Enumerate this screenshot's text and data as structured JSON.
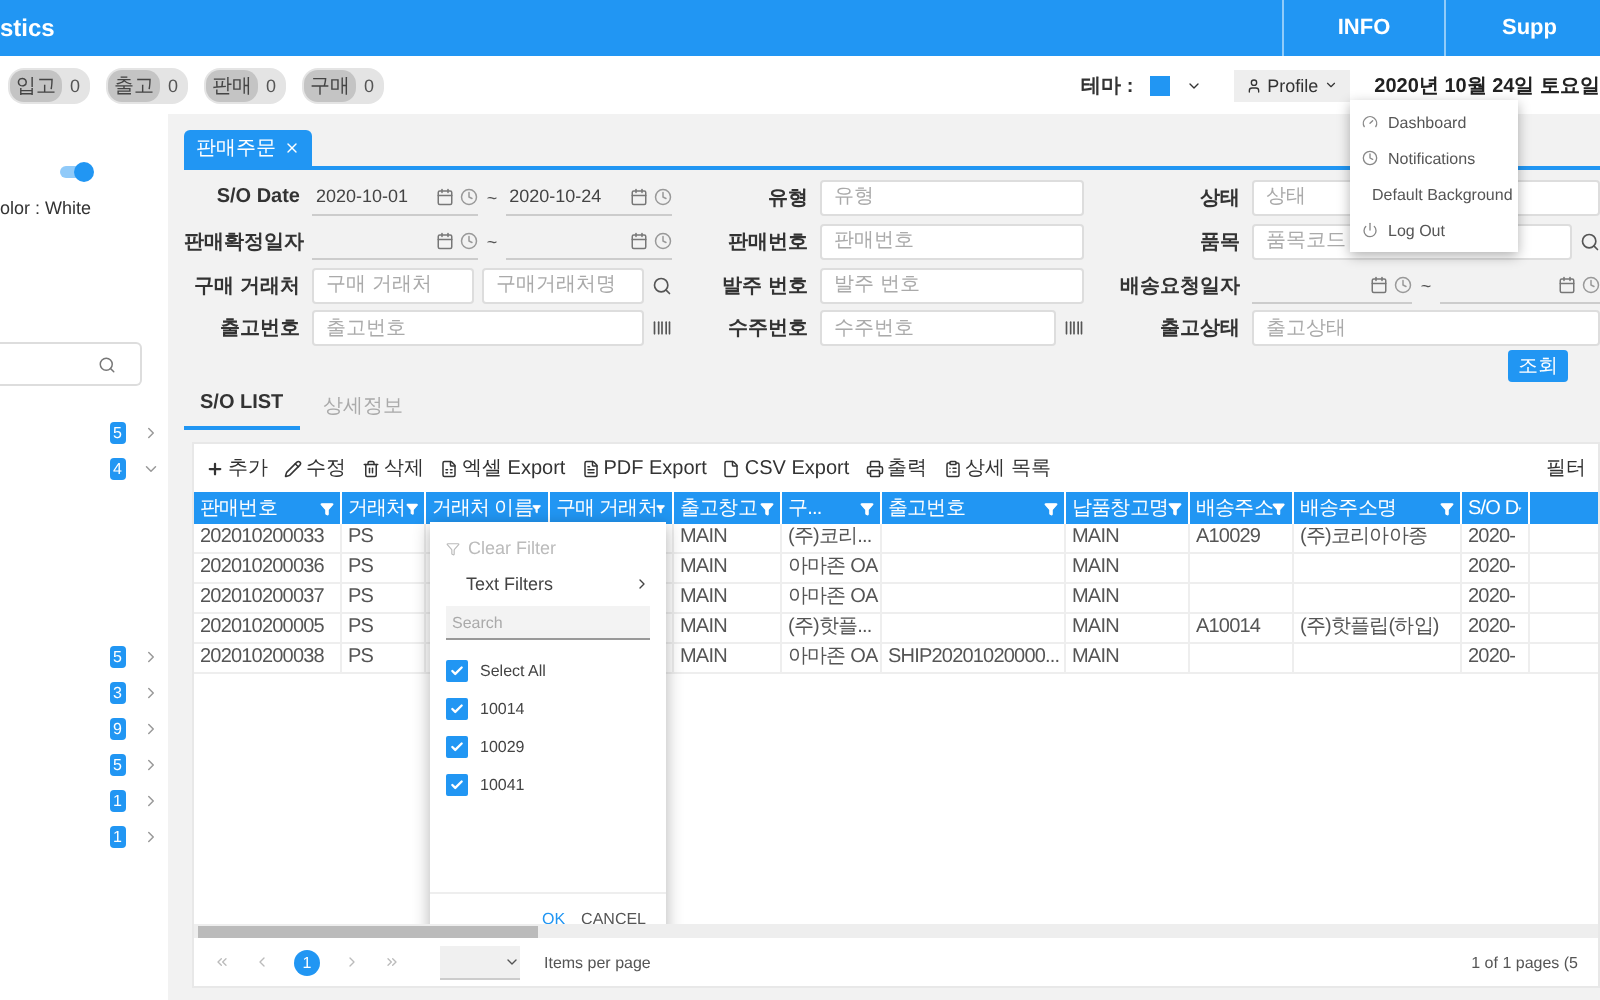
{
  "header": {
    "title": "stics",
    "nav": [
      "INFO",
      "Supp"
    ]
  },
  "counters": [
    {
      "label": "입고",
      "count": "0"
    },
    {
      "label": "출고",
      "count": "0"
    },
    {
      "label": "판매",
      "count": "0"
    },
    {
      "label": "구매",
      "count": "0"
    }
  ],
  "theme": {
    "label": "테마 :",
    "color": "#2196f3"
  },
  "profile": {
    "label": "Profile",
    "menu": [
      {
        "label": "Dashboard",
        "kind": "dashboard"
      },
      {
        "label": "Notifications",
        "kind": "notifications"
      },
      {
        "label": "Default Background",
        "kind": "background"
      },
      {
        "label": "Log Out",
        "kind": "logout"
      }
    ]
  },
  "date": "2020년 10월 24일 토요일",
  "sidebar": {
    "toggle": {
      "on": true
    },
    "theme_text": "olor : White",
    "items": [
      {
        "count": "5",
        "expanded": false
      },
      {
        "count": "4",
        "expanded": true
      },
      {
        "count": "5",
        "expanded": false
      },
      {
        "count": "3",
        "expanded": false
      },
      {
        "count": "9",
        "expanded": false
      },
      {
        "count": "5",
        "expanded": false
      },
      {
        "count": "1",
        "expanded": false
      },
      {
        "count": "1",
        "expanded": false
      }
    ]
  },
  "doc_tabs": [
    {
      "label": "판매주문",
      "selected": true
    }
  ],
  "filters": [
    {
      "kind": "date_range",
      "label": "S/O Date",
      "from": "2020-10-01",
      "separator": "~",
      "to": "2020-10-24"
    },
    {
      "kind": "text",
      "label": "유형",
      "placeholder": "유형"
    },
    {
      "kind": "text",
      "label": "상태",
      "placeholder": "상태"
    },
    {
      "kind": "date_range",
      "label": "판매확정일자",
      "separator": "~"
    },
    {
      "kind": "text",
      "label": "판매번호",
      "placeholder": "판매번호"
    },
    {
      "kind": "text_search",
      "label": "품목",
      "placeholder": "품목코드"
    },
    {
      "kind": "text_pair",
      "label": "구매 거래처",
      "placeholders": [
        "구매 거래처",
        "구매거래처명"
      ]
    },
    {
      "kind": "text",
      "label": "발주 번호",
      "placeholder": "발주 번호"
    },
    {
      "kind": "date_range",
      "label": "배송요청일자",
      "separator": "~"
    },
    {
      "kind": "text_barcode",
      "label": "출고번호",
      "placeholder": "출고번호"
    },
    {
      "kind": "text_barcode",
      "label": "수주번호",
      "placeholder": "수주번호"
    },
    {
      "kind": "text",
      "label": "출고상태",
      "placeholder": "출고상태"
    }
  ],
  "search_button": "조회",
  "list_tabs": [
    {
      "label": "S/O LIST",
      "selected": true
    },
    {
      "label": "상세정보",
      "selected": false
    }
  ],
  "toolbar": [
    {
      "label": "추가",
      "kind": "add"
    },
    {
      "label": "수정",
      "kind": "edit"
    },
    {
      "label": "삭제",
      "kind": "delete"
    },
    {
      "label": "엑셀 Export",
      "kind": "excel"
    },
    {
      "label": "PDF Export",
      "kind": "pdf"
    },
    {
      "label": "CSV Export",
      "kind": "csv"
    },
    {
      "label": "출력",
      "kind": "print"
    },
    {
      "label": "상세 목록",
      "kind": "detail"
    }
  ],
  "toolbar_right": "필터",
  "table": {
    "columns": [
      "판매번호",
      "거래처",
      "거래처 이름",
      "구매 거래처",
      "출고창고",
      "구...",
      "출고번호",
      "납품창고명",
      "배송주소",
      "배송주소명",
      "S/O D"
    ],
    "rows": [
      [
        "202010200033",
        "PS",
        null,
        null,
        "MAIN",
        "(주)코리...",
        null,
        "MAIN",
        "A10029",
        "(주)코리아아종",
        "2020-"
      ],
      [
        "202010200036",
        "PS",
        null,
        null,
        "MAIN",
        "아마존 OA",
        null,
        "MAIN",
        null,
        null,
        "2020-"
      ],
      [
        "202010200037",
        "PS",
        null,
        null,
        "MAIN",
        "아마존 OA",
        null,
        "MAIN",
        null,
        null,
        "2020-"
      ],
      [
        "202010200005",
        "PS",
        null,
        null,
        "MAIN",
        "(주)핫플...",
        null,
        "MAIN",
        "A10014",
        "(주)핫플립(하입)",
        "2020-"
      ],
      [
        "202010200038",
        "PS",
        null,
        null,
        "MAIN",
        "아마존 OA",
        "SHIP20201020000...",
        "MAIN",
        null,
        null,
        "2020-"
      ]
    ]
  },
  "filter_popup": {
    "clear": {
      "label": "Clear Filter",
      "disabled": true
    },
    "text_filters": "Text Filters",
    "search": {
      "placeholder": "Search"
    },
    "options": [
      {
        "label": "Select All",
        "checked": true
      },
      {
        "label": "10014",
        "checked": true
      },
      {
        "label": "10029",
        "checked": true
      },
      {
        "label": "10041",
        "checked": true
      }
    ],
    "buttons": [
      {
        "label": "OK",
        "kind": "primary"
      },
      {
        "label": "CANCEL",
        "kind": "secondary"
      }
    ]
  },
  "pager": {
    "pages": [
      {
        "label": "1",
        "selected": true
      }
    ],
    "page_size_label": "Items per page",
    "summary": "1 of 1 pages (5"
  }
}
